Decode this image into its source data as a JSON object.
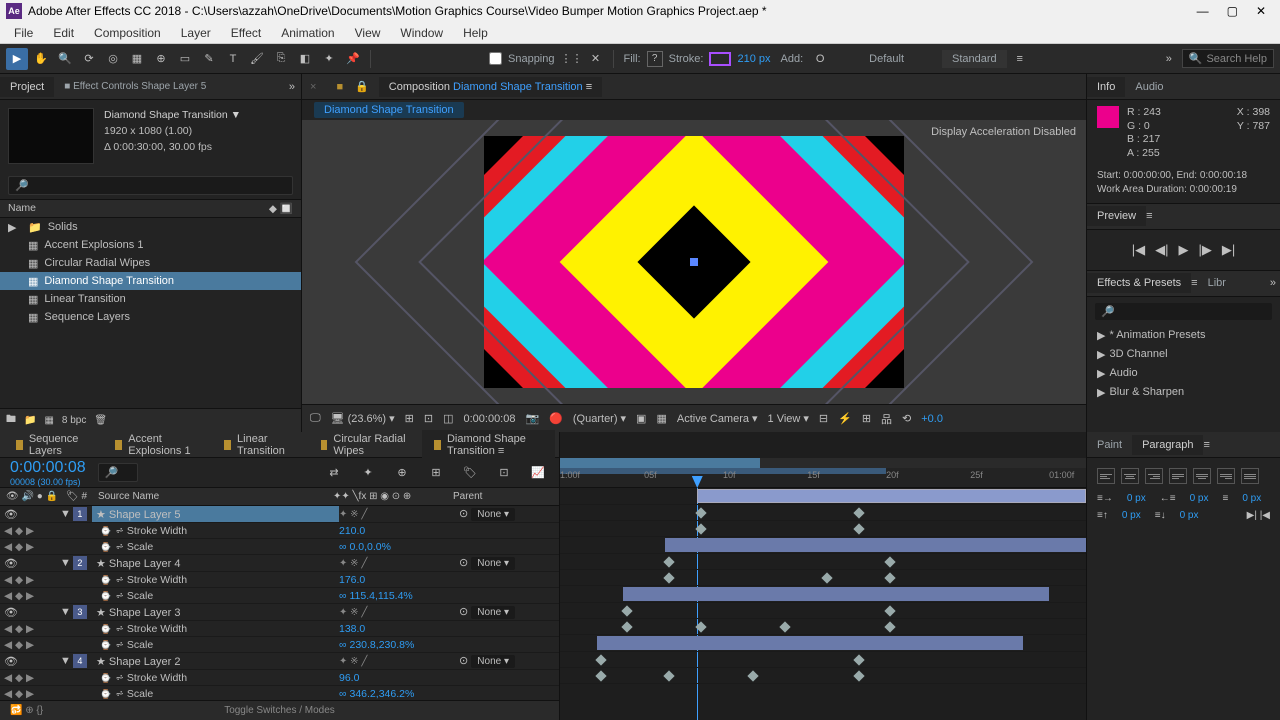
{
  "titlebar": {
    "title": "Adobe After Effects CC 2018 - C:\\Users\\azzah\\OneDrive\\Documents\\Motion Graphics Course\\Video Bumper Motion Graphics Project.aep *"
  },
  "menubar": [
    "File",
    "Edit",
    "Composition",
    "Layer",
    "Effect",
    "Animation",
    "View",
    "Window",
    "Help"
  ],
  "toolbar": {
    "snapping": "Snapping",
    "fill": "Fill:",
    "stroke": "Stroke:",
    "stroke_px": "210 px",
    "add": "Add:",
    "workspace": "Default",
    "layout": "Standard",
    "search_ph": "Search Help"
  },
  "project": {
    "tab1": "Project",
    "tab2": "Effect Controls Shape Layer 5",
    "comp_name": "Diamond Shape Transition ▼",
    "comp_res": "1920 x 1080 (1.00)",
    "comp_dur": "Δ 0:00:30:00, 30.00 fps",
    "col_name": "Name",
    "items": [
      {
        "name": "Solids",
        "type": "folder"
      },
      {
        "name": "Accent Explosions 1",
        "type": "comp"
      },
      {
        "name": "Circular Radial Wipes",
        "type": "comp"
      },
      {
        "name": "Diamond Shape Transition",
        "type": "comp",
        "sel": true
      },
      {
        "name": "Linear Transition",
        "type": "comp"
      },
      {
        "name": "Sequence Layers",
        "type": "comp"
      }
    ],
    "footer_bpc": "8 bpc"
  },
  "composition": {
    "tab": "Composition",
    "name": "Diamond Shape Transition",
    "breadcrumb": "Diamond Shape Transition",
    "disp_accel": "Display Acceleration Disabled",
    "zoom": "(23.6%)",
    "time": "0:00:00:08",
    "quality": "(Quarter)",
    "camera": "Active Camera",
    "view": "1 View",
    "exposure": "+0.0"
  },
  "info": {
    "tab1": "Info",
    "tab2": "Audio",
    "r": "R : 243",
    "g": "G : 0",
    "b": "B : 217",
    "a": "A : 255",
    "x": "X : 398",
    "y": "Y : 787",
    "start": "Start: 0:00:00:00, End: 0:00:00:18",
    "work": "Work Area Duration: 0:00:00:19"
  },
  "preview": {
    "tab": "Preview"
  },
  "effects": {
    "tab1": "Effects & Presets",
    "tab2": "Libr",
    "items": [
      "* Animation Presets",
      "3D Channel",
      "Audio",
      "Blur & Sharpen"
    ]
  },
  "timeline": {
    "tabs": [
      {
        "label": "Sequence Layers"
      },
      {
        "label": "Accent Explosions 1"
      },
      {
        "label": "Linear Transition"
      },
      {
        "label": "Circular Radial Wipes"
      },
      {
        "label": "Diamond Shape Transition",
        "active": true
      }
    ],
    "timecode": "0:00:00:08",
    "frames": "00008 (30.00 fps)",
    "col_src": "Source Name",
    "col_parent": "Parent",
    "footer": "Toggle Switches / Modes",
    "ruler": [
      "1:00f",
      "05f",
      "10f",
      "15f",
      "20f",
      "25f",
      "01:00f"
    ],
    "layers": [
      {
        "idx": "1",
        "name": "Shape Layer 5",
        "sel": true,
        "parent": "None",
        "props": [
          {
            "name": "Stroke Width",
            "val": "210.0"
          },
          {
            "name": "Scale",
            "val": "0.0,0.0%",
            "link": true
          }
        ]
      },
      {
        "idx": "2",
        "name": "Shape Layer 4",
        "parent": "None",
        "props": [
          {
            "name": "Stroke Width",
            "val": "176.0"
          },
          {
            "name": "Scale",
            "val": "115.4,115.4%",
            "link": true
          }
        ]
      },
      {
        "idx": "3",
        "name": "Shape Layer 3",
        "parent": "None",
        "props": [
          {
            "name": "Stroke Width",
            "val": "138.0"
          },
          {
            "name": "Scale",
            "val": "230.8,230.8%",
            "link": true
          }
        ]
      },
      {
        "idx": "4",
        "name": "Shape Layer 2",
        "parent": "None",
        "props": [
          {
            "name": "Stroke Width",
            "val": "96.0"
          },
          {
            "name": "Scale",
            "val": "346.2,346.2%",
            "link": true
          }
        ]
      }
    ]
  },
  "paragraph": {
    "tab1": "Paint",
    "tab2": "Paragraph",
    "px": "0 px"
  }
}
